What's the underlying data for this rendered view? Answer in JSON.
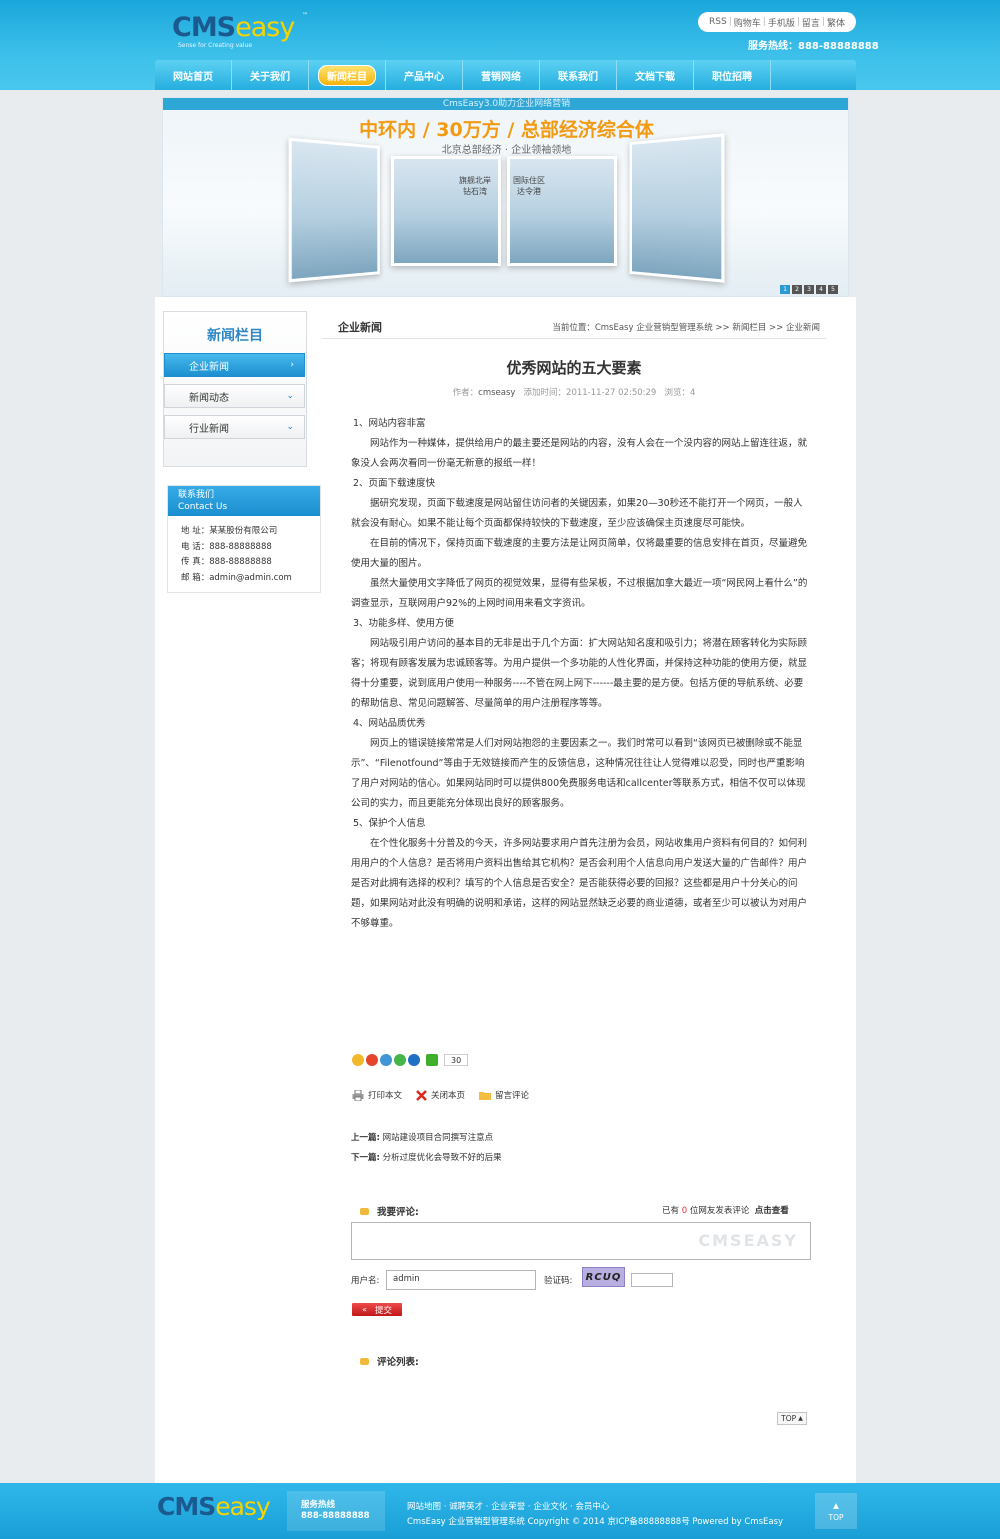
{
  "header": {
    "logo_main": "CMS",
    "logo_sub": "easy",
    "logo_tm": "™",
    "logo_tagline": "Sense for Creating value",
    "toplinks": [
      "RSS",
      "购物车",
      "手机版",
      "留言",
      "繁体"
    ],
    "hotline": "服务热线：888-88888888"
  },
  "nav": {
    "items": [
      "网站首页",
      "关于我们",
      "新闻栏目",
      "产品中心",
      "营销网络",
      "联系我们",
      "文档下载",
      "职位招聘"
    ],
    "active_index": 2
  },
  "banner": {
    "caption": "CmsEasy3.0助力企业网络营销",
    "headline": "中环内 / 30万方 / 总部经济综合体",
    "subline": "北京总部经济 · 企业领袖领地",
    "label_a": "旗舰北岸\n钻石湾",
    "label_b": "国际住区\n达令港",
    "dots": [
      "1",
      "2",
      "3",
      "4",
      "5"
    ]
  },
  "sidebar": {
    "title": "新闻栏目",
    "items": [
      {
        "label": "企业新闻",
        "active": true
      },
      {
        "label": "新闻动态",
        "active": false
      },
      {
        "label": "行业新闻",
        "active": false
      }
    ],
    "contact_title": "联系我们",
    "contact_sub": "Contact Us",
    "contact_rows": [
      "地 址：某某股份有限公司",
      "电 话：888-88888888",
      "传 真：888-88888888",
      "邮 箱：admin@admin.com"
    ]
  },
  "breadcrumb": {
    "section": "企业新闻",
    "trail": "当前位置：CmsEasy 企业营销型管理系统  >> 新闻栏目  >> 企业新闻"
  },
  "article": {
    "title": "优秀网站的五大要素",
    "author_label": "作者：",
    "author": "cmseasy",
    "time_label": "添加时间：",
    "time": "2011-11-27 02:50:29",
    "views_label": "浏览：",
    "views": "4",
    "blocks": [
      {
        "t": "h",
        "text": "1、网站内容非富"
      },
      {
        "t": "p",
        "text": "网站作为一种媒体，提供给用户的最主要还是网站的内容，没有人会在一个没内容的网站上留连往返，就象没人会两次看同一份毫无新意的报纸一样！"
      },
      {
        "t": "h",
        "text": "2、页面下载速度快"
      },
      {
        "t": "p",
        "text": "据研究发现，页面下载速度是网站留住访问者的关键因素，如果20—30秒还不能打开一个网页，一般人就会没有耐心。如果不能让每个页面都保持较快的下载速度，至少应该确保主页速度尽可能快。"
      },
      {
        "t": "p",
        "text": "在目前的情况下，保持页面下载速度的主要方法是让网页简单，仅将最重要的信息安排在首页，尽量避免使用大量的图片。"
      },
      {
        "t": "p",
        "text": "虽然大量使用文字降低了网页的视觉效果，显得有些呆板，不过根据加拿大最近一项“网民网上看什么”的调查显示，互联网用户92%的上网时间用来看文字资讯。"
      },
      {
        "t": "h",
        "text": "3、功能多样、使用方便"
      },
      {
        "t": "p",
        "text": "网站吸引用户访问的基本目的无非是出于几个方面：扩大网站知名度和吸引力；将潜在顾客转化为实际顾客；将现有顾客发展为忠诚顾客等。为用户提供一个多功能的人性化界面，并保持这种功能的使用方便，就显得十分重要，说到底用户使用一种服务----不管在网上网下------最主要的是方便。包括方便的导航系统、必要的帮助信息、常见问题解答、尽量简单的用户注册程序等等。"
      },
      {
        "t": "h",
        "text": "4、网站品质优秀"
      },
      {
        "t": "p",
        "text": "网页上的错误链接常常是人们对网站抱怨的主要因素之一。我们时常可以看到“该网页已被删除或不能显示”、“Filenotfound”等由于无效链接而产生的反馈信息，这种情况往往让人觉得难以忍受，同时也严重影响了用户对网站的信心。如果网站同时可以提供800免费服务电话和callcenter等联系方式，相信不仅可以体现公司的实力，而且更能充分体现出良好的顾客服务。"
      },
      {
        "t": "h",
        "text": "5、保护个人信息"
      },
      {
        "t": "p",
        "text": "在个性化服务十分普及的今天，许多网站要求用户首先注册为会员，网站收集用户资料有何目的？如何利用用户的个人信息？是否将用户资料出售给其它机构？是否会利用个人信息向用户发送大量的广告邮件？用户是否对此拥有选择的权利？填写的个人信息是否安全？是否能获得必要的回报？这些都是用户十分关心的问题，如果网站对此没有明确的说明和承诺，这样的网站显然缺乏必要的商业道德，或者至少可以被认为对用户不够尊重。"
      }
    ]
  },
  "share": {
    "count": "30",
    "icons": [
      "qzone-icon",
      "weibo-icon",
      "qq-icon",
      "wechat-icon",
      "renren-icon",
      "more-share-icon"
    ]
  },
  "tools": {
    "print": "打印本文",
    "close": "关闭本页",
    "comment": "留言评论"
  },
  "prevnext": {
    "prev_label": "上一篇:",
    "prev": "网站建设项目合同撰写注意点",
    "next_label": "下一篇:",
    "next": "分析过度优化会导致不好的后果"
  },
  "comment": {
    "heading": "我要评论:",
    "stat_prefix": "已有",
    "stat_count": "0",
    "stat_suffix": "位网友发表评论",
    "view_all": "点击查看",
    "watermark": "CMSEASY",
    "username_label": "用户名:",
    "username_value": "admin",
    "captcha_label": "验证码:",
    "captcha_text": "RCUQ",
    "submit": "提交",
    "list_heading": "评论列表:"
  },
  "top_button": "TOP",
  "footer": {
    "logo_main": "CMS",
    "logo_sub": "easy",
    "svc_title": "服务热线",
    "svc_phone": "888-88888888",
    "links": "网站地图 · 诚聘英才 · 企业荣誉 · 企业文化 · 会员中心",
    "copyright": "CmsEasy 企业营销型管理系统 Copyright © 2014 京ICP备88888888号 Powered by CmsEasy",
    "top": "TOP"
  },
  "colors": {
    "accent": "#1b8ed0",
    "nav_active": "#f5b40b",
    "brand_dark": "#1b5a8f",
    "brand_yellow": "#f7d400"
  }
}
